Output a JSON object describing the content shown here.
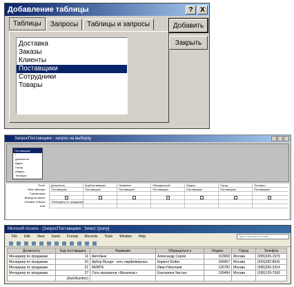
{
  "dialog": {
    "title": "Добавление таблицы",
    "help_btn": "?",
    "close_btn": "X",
    "tabs": [
      "Таблицы",
      "Запросы",
      "Таблицы и запросы"
    ],
    "tables": [
      "Доставка",
      "Заказы",
      "Клиенты",
      "Поставщики",
      "Сотрудники",
      "Товары"
    ],
    "selected": "Поставщики",
    "add_label": "Добавить",
    "close_label": "Закрыть"
  },
  "query_design": {
    "title": "ЗапросПоставщики : запрос на выборку",
    "table_title": "Поставщики",
    "table_fields": [
      "*",
      "Должность",
      "Адрес",
      "Город",
      "Индекс",
      "Телефон"
    ],
    "row_labels": [
      "Поле:",
      "Имя таблицы:",
      "Сортировка:",
      "Вывод на экран:",
      "Условие отбора:",
      "или:"
    ],
    "columns": [
      {
        "field": "Должность",
        "table": "Поставщики",
        "criteria": "\"Менеджер по продажам\""
      },
      {
        "field": "КодПоставщика",
        "table": "Поставщики",
        "criteria": ""
      },
      {
        "field": "Название",
        "table": "Поставщики",
        "criteria": ""
      },
      {
        "field": "ОбращатьсяК",
        "table": "Поставщики",
        "criteria": ""
      },
      {
        "field": "Индекс",
        "table": "Поставщики",
        "criteria": ""
      },
      {
        "field": "Город",
        "table": "Поставщики",
        "criteria": ""
      },
      {
        "field": "Телефон",
        "table": "Поставщики",
        "criteria": ""
      }
    ]
  },
  "access": {
    "title": "Microsoft Access - [ЗапросПоставщики : Select Query]",
    "menu": [
      "File",
      "Edit",
      "View",
      "Insert",
      "Format",
      "Records",
      "Tools",
      "Window",
      "Help"
    ],
    "help_placeholder": "Type a question for help",
    "headers": [
      "Должность",
      "Код поставщика",
      "Название",
      "Обращаться к",
      "Индекс",
      "Город",
      "Телефон"
    ],
    "rows": [
      [
        "Менеджер по продажам",
        "11",
        "Автобанк",
        "Александр Серов",
        "103658",
        "Москва",
        "(095)326-1579"
      ],
      [
        "Менеджер по продажам",
        "10",
        "Арбор Мунди - сеть парфюмерных",
        "Кирилл Бойко",
        "189367",
        "Москва",
        "(926)282-8641"
      ],
      [
        "Менеджер по продажам",
        "21",
        "МИИГА",
        "Иван Николаев",
        "125783",
        "Москва",
        "(095)300-3314"
      ],
      [
        "Менеджер по продажам",
        "27",
        "Сеть магазинов «Мегалюкс»",
        "Екатерина Чистых",
        "105484",
        "Москва",
        "(095)129-7593"
      ]
    ],
    "new_row": "(AutoNumber)"
  }
}
